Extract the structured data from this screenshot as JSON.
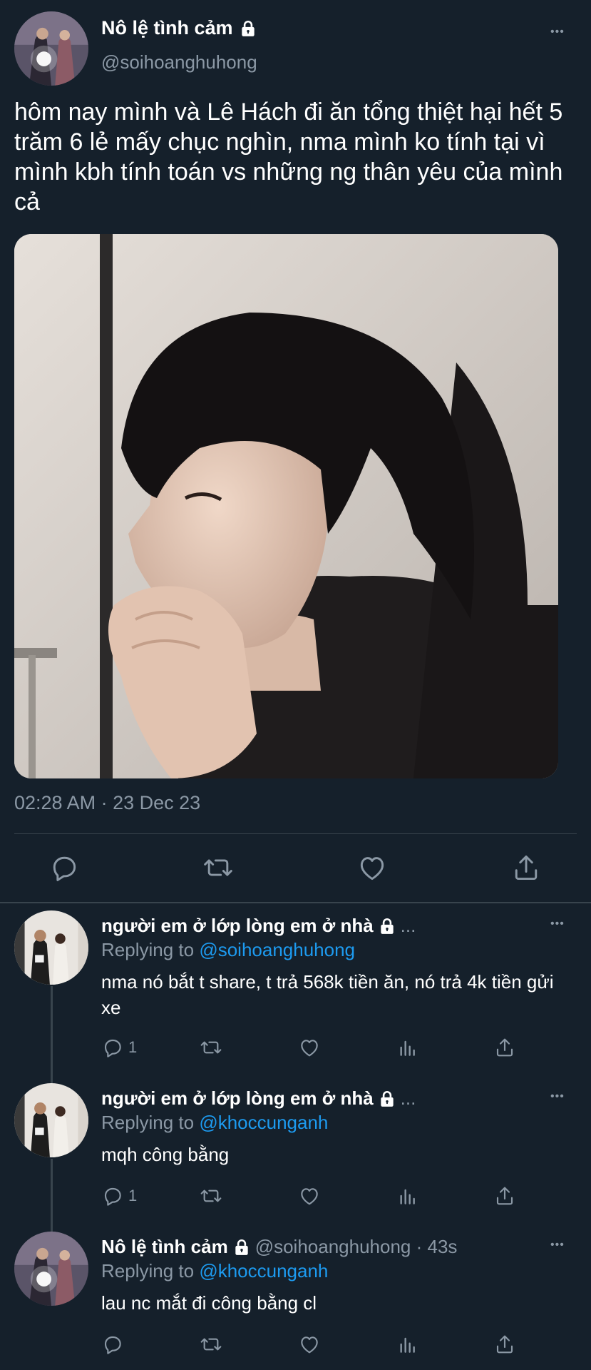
{
  "main_tweet": {
    "name": "Nô lệ tình cảm",
    "handle": "@soihoanghuhong",
    "more": "•••",
    "text": "hôm nay mình và Lê Hách đi ăn tổng thiệt hại hết 5 trăm 6 lẻ mấy chục nghìn, nma mình ko tính tại vì mình kbh tính toán vs những ng thân yêu của mình cả",
    "timestamp": "02:28 AM · 23 Dec 23"
  },
  "replies": [
    {
      "name": "người em ở lớp lòng em ở nhà",
      "ellipsis": "...",
      "replying_prefix": "Replying to",
      "replying_to": "@soihoanghuhong",
      "text": "nma nó bắt t share, t trả 568k tiền ăn, nó trả 4k tiền gửi xe",
      "reply_count": "1"
    },
    {
      "name": "người em ở lớp lòng em ở nhà",
      "ellipsis": "...",
      "replying_prefix": "Replying to",
      "replying_to": "@khoccunganh",
      "text": "mqh công bằng",
      "reply_count": "1"
    },
    {
      "name": "Nô lệ tình cảm",
      "handle_time": "@soihoanghuhong · 43s",
      "replying_prefix": "Replying to",
      "replying_to": "@khoccunganh",
      "text": "lau nc mắt đi công bằng cl",
      "reply_count": ""
    }
  ],
  "colors": {
    "background": "#15202b",
    "muted": "#8b98a5",
    "link": "#1d9bf0",
    "divider": "#38444d"
  },
  "icons": [
    "lock-icon",
    "more-icon",
    "reply-icon",
    "retweet-icon",
    "like-icon",
    "share-icon",
    "analytics-icon"
  ]
}
